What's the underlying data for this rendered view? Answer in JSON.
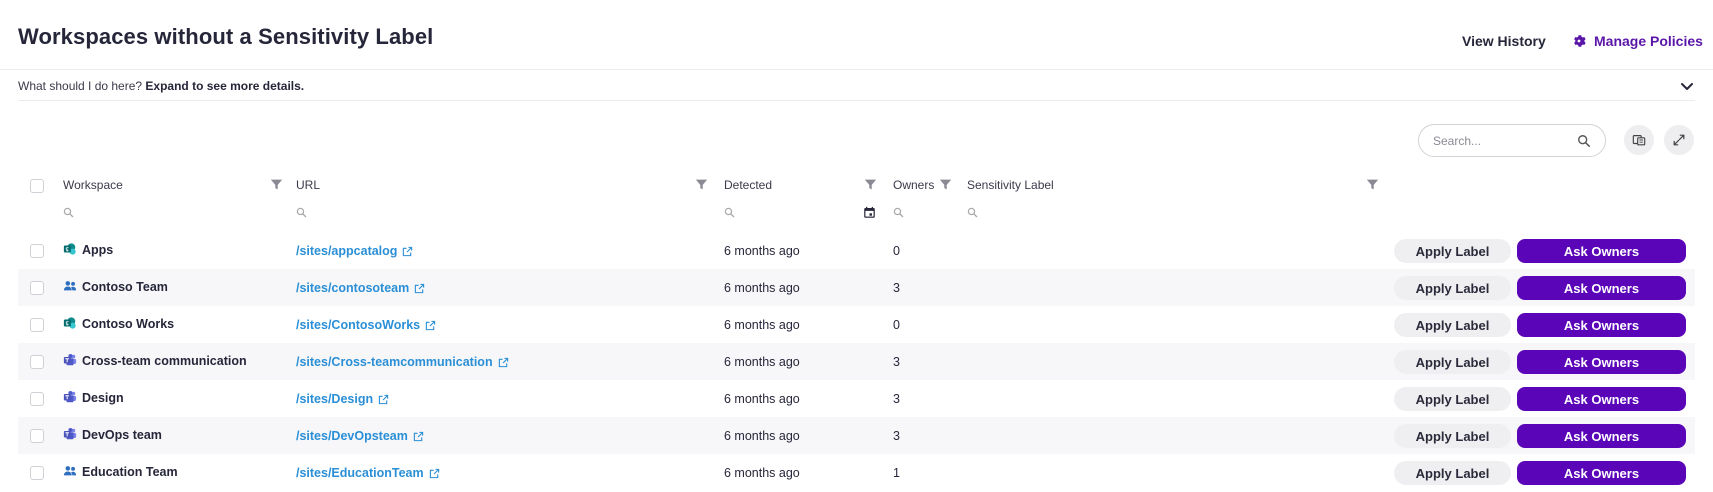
{
  "header": {
    "title": "Workspaces without a Sensitivity Label",
    "view_history": "View History",
    "manage_policies": "Manage Policies"
  },
  "expander": {
    "question": "What should I do here?",
    "action": "Expand to see more details."
  },
  "search": {
    "placeholder": "Search...",
    "value": ""
  },
  "table": {
    "columns": {
      "workspace": "Workspace",
      "url": "URL",
      "detected": "Detected",
      "owners": "Owners",
      "sensitivity_label": "Sensitivity Label"
    },
    "apply_label": "Apply Label",
    "ask_owners": "Ask Owners",
    "rows": [
      {
        "name": "Apps",
        "type": "sharepoint",
        "url": "/sites/appcatalog",
        "detected": "6 months ago",
        "owners": "0"
      },
      {
        "name": "Contoso Team",
        "type": "group",
        "url": "/sites/contosoteam",
        "detected": "6 months ago",
        "owners": "3"
      },
      {
        "name": "Contoso Works",
        "type": "sharepoint",
        "url": "/sites/ContosoWorks",
        "detected": "6 months ago",
        "owners": "0"
      },
      {
        "name": "Cross-team communication",
        "type": "teams",
        "url": "/sites/Cross-teamcommunication",
        "detected": "6 months ago",
        "owners": "3"
      },
      {
        "name": "Design",
        "type": "teams",
        "url": "/sites/Design",
        "detected": "6 months ago",
        "owners": "3"
      },
      {
        "name": "DevOps team",
        "type": "teams",
        "url": "/sites/DevOpsteam",
        "detected": "6 months ago",
        "owners": "3"
      },
      {
        "name": "Education Team",
        "type": "group",
        "url": "/sites/EducationTeam",
        "detected": "6 months ago",
        "owners": "1"
      }
    ]
  },
  "colors": {
    "accent": "#5b05b8",
    "link": "#2a8fd6",
    "sharepoint_icon": "#0f8a8a",
    "group_icon": "#2f6fc0",
    "teams_icon": "#5059c9"
  },
  "icons": {
    "gear": "gear-icon",
    "chevron": "chevron-down-icon",
    "search": "search-icon",
    "export": "export-icon",
    "expand": "expand-icon",
    "filter": "filter-icon",
    "calendar": "calendar-icon",
    "external_link": "external-link-icon"
  }
}
